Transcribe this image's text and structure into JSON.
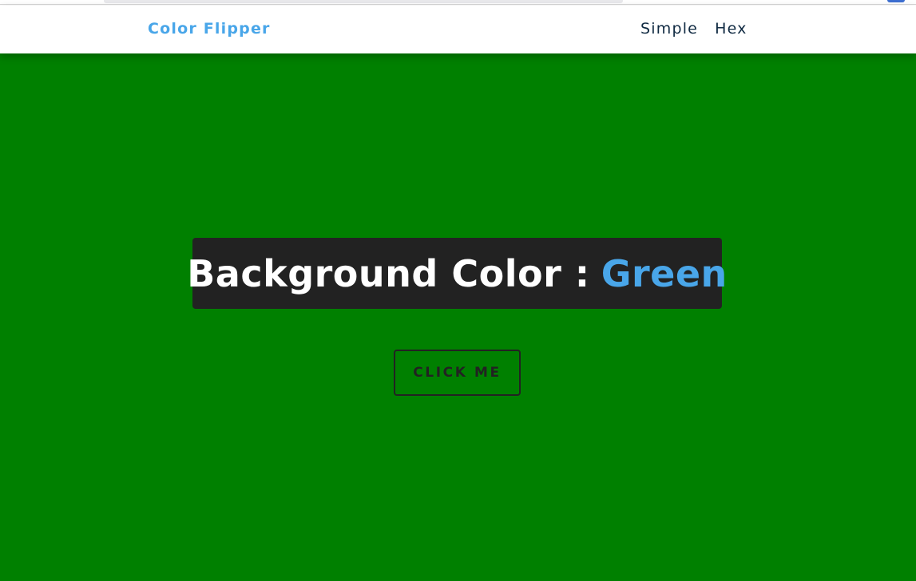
{
  "navbar": {
    "brand": "Color Flipper",
    "links": [
      "Simple",
      "Hex"
    ]
  },
  "main": {
    "heading_prefix": "Background Color :",
    "color_name": "Green",
    "button_label": "CLICK ME"
  },
  "colors": {
    "background": "#008000",
    "accent": "#49a6e9",
    "dark": "#222222",
    "nav_text": "#102a42"
  }
}
